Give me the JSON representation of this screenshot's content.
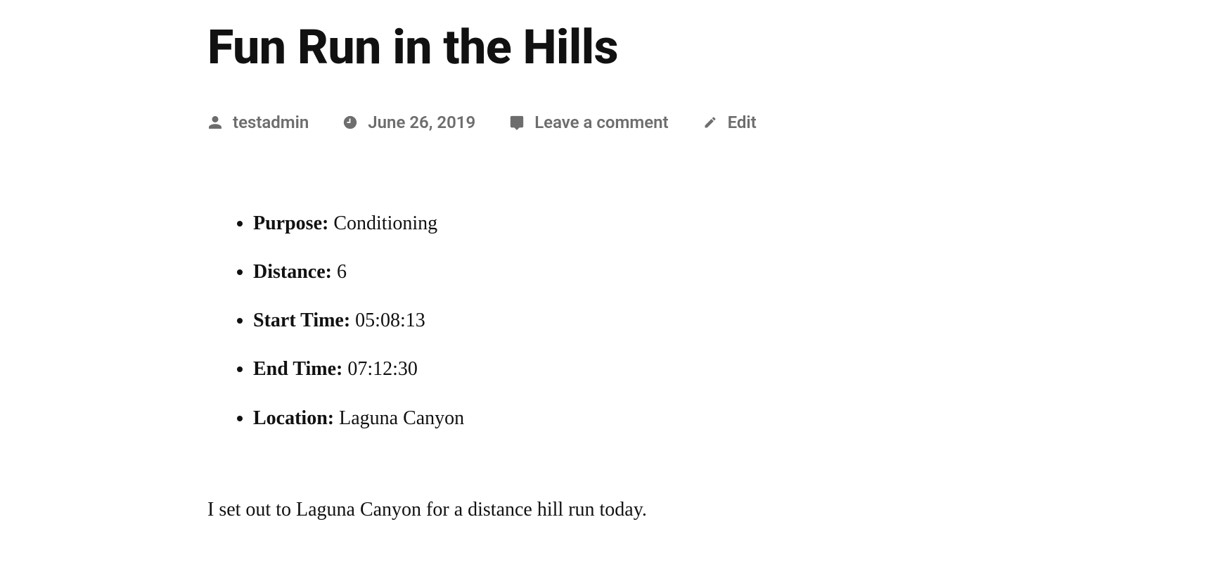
{
  "post": {
    "title": "Fun Run in the Hills",
    "body": "I set out to Laguna Canyon for a distance hill run today."
  },
  "meta": {
    "author": "testadmin",
    "date": "June 26, 2019",
    "comment_link": "Leave a comment",
    "edit_link": "Edit"
  },
  "details": [
    {
      "label": "Purpose:",
      "value": "Conditioning"
    },
    {
      "label": "Distance:",
      "value": "6"
    },
    {
      "label": "Start Time:",
      "value": "05:08:13"
    },
    {
      "label": "End Time:",
      "value": "07:12:30"
    },
    {
      "label": "Location:",
      "value": "Laguna Canyon"
    }
  ]
}
